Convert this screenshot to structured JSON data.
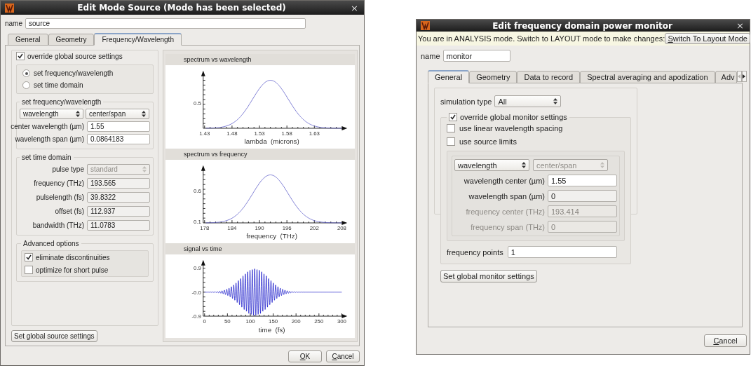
{
  "source_dialog": {
    "title": "Edit Mode Source (Mode has been selected)",
    "close": "×",
    "name_label": "name",
    "name_value": "source",
    "tabs": [
      {
        "label": "General",
        "selected": false
      },
      {
        "label": "Geometry",
        "selected": false
      },
      {
        "label": "Frequency/Wavelength",
        "selected": true
      }
    ],
    "override": {
      "label": "override global source settings",
      "checked": true
    },
    "modes": [
      {
        "label": "set frequency/wavelength",
        "selected": true
      },
      {
        "label": "set time domain",
        "selected": false
      }
    ],
    "frequency_group": {
      "title": "set frequency/wavelength",
      "selects": [
        {
          "value": "wavelength",
          "disabled": false
        },
        {
          "value": "center/span",
          "disabled": false
        }
      ],
      "fields": [
        {
          "label": "center wavelength (µm)",
          "value": "1.55",
          "readonly": false,
          "disabled": false
        },
        {
          "label": "wavelength span (µm)",
          "value": "0.0864183",
          "readonly": false,
          "disabled": false
        }
      ]
    },
    "time_group": {
      "title": "set time domain",
      "pulse_type": {
        "label": "pulse type",
        "value": "standard",
        "disabled": true
      },
      "fields": [
        {
          "label": "frequency (THz)",
          "value": "193.565",
          "readonly": true,
          "disabled": false
        },
        {
          "label": "pulselength (fs)",
          "value": "39.8322",
          "readonly": true,
          "disabled": false
        },
        {
          "label": "offset (fs)",
          "value": "112.937",
          "readonly": true,
          "disabled": false
        },
        {
          "label": "bandwidth (THz)",
          "value": "11.0783",
          "readonly": true,
          "disabled": false
        }
      ]
    },
    "advanced_group": {
      "title": "Advanced options",
      "options": [
        {
          "label": "eliminate discontinuities",
          "checked": true
        },
        {
          "label": "optimize for short pulse",
          "checked": false
        }
      ]
    },
    "global_button": "Set global source settings",
    "charts": [
      {
        "title": "spectrum vs wavelength",
        "kind": "spectrum",
        "xticks": [
          "1.43",
          "1.48",
          "1.53",
          "1.58",
          "1.63"
        ],
        "yticks": [
          "0.5"
        ],
        "xlabel": "lambda  (microns)"
      },
      {
        "title": "spectrum vs frequency",
        "kind": "spectrum",
        "xticks": [
          "178",
          "184",
          "190",
          "196",
          "202",
          "208"
        ],
        "yticks": [
          "0.6",
          "0.1"
        ],
        "xlabel": "frequency  (THz)"
      },
      {
        "title": "signal vs time",
        "kind": "pulse",
        "xticks": [
          "0",
          "50",
          "100",
          "150",
          "200",
          "250",
          "300"
        ],
        "yticks": [
          "0.9",
          "-0.0",
          "-0.9"
        ],
        "xlabel": "time  (fs)"
      }
    ],
    "buttons": [
      "OK",
      "Cancel"
    ]
  },
  "monitor_dialog": {
    "title": "Edit frequency domain power monitor",
    "close": "×",
    "info": "You are in ANALYSIS mode.  Switch to LAYOUT mode to make changes:",
    "switch_button": "Switch To Layout Mode",
    "name_label": "name",
    "name_value": "monitor",
    "tabs": [
      {
        "label": "General",
        "selected": true
      },
      {
        "label": "Geometry",
        "selected": false
      },
      {
        "label": "Data to record",
        "selected": false
      },
      {
        "label": "Spectral averaging and apodization",
        "selected": false
      },
      {
        "label": "Adv",
        "selected": false
      }
    ],
    "simulation_type": {
      "label": "simulation type",
      "value": "All"
    },
    "override": {
      "label": "override global monitor settings",
      "checked": true
    },
    "options": [
      {
        "label": "use linear wavelength spacing",
        "checked": false
      },
      {
        "label": "use source limits",
        "checked": false
      }
    ],
    "selects": [
      {
        "value": "wavelength",
        "disabled": false
      },
      {
        "value": "center/span",
        "disabled": true
      }
    ],
    "fields": [
      {
        "label": "wavelength center (µm)",
        "value": "1.55",
        "readonly": false,
        "disabled": false
      },
      {
        "label": "wavelength span (µm)",
        "value": "0",
        "readonly": true,
        "disabled": false
      },
      {
        "label": "frequency center (THz)",
        "value": "193.414",
        "readonly": true,
        "disabled": true
      },
      {
        "label": "frequency span (THz)",
        "value": "0",
        "readonly": true,
        "disabled": true
      }
    ],
    "frequency_points": {
      "label": "frequency points",
      "value": "1"
    },
    "global_button": "Set global monitor settings",
    "cancel": "Cancel"
  }
}
